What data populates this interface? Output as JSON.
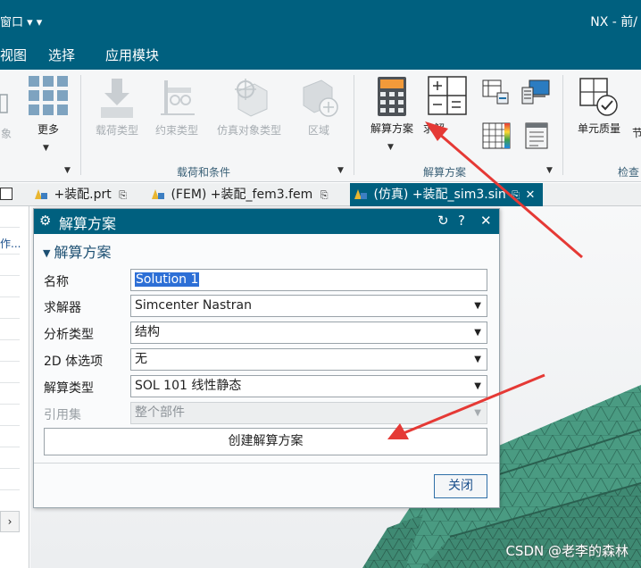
{
  "titlebar": {
    "left_text": "窗口 ▾  ▾",
    "right_text": "NX - 前/"
  },
  "menubar": {
    "items": [
      "视图",
      "选择",
      "应用模块"
    ]
  },
  "ribbon": {
    "buttons": {
      "more": "更多",
      "load_type": "载荷类型",
      "constraint_type": "约束类型",
      "sim_object_type": "仿真对象类型",
      "region": "区域",
      "solution": "解算方案",
      "solve": "求解",
      "element_quality": "单元质量",
      "partial_left": "象",
      "partial_right": "节"
    },
    "groups": {
      "loads_conditions": "载荷和条件",
      "solution": "解算方案",
      "check": "检查"
    }
  },
  "tabs": [
    {
      "label": "+装配.prt",
      "active": false
    },
    {
      "label": "(FEM) +装配_fem3.fem",
      "active": false
    },
    {
      "label": "(仿真) +装配_sim3.sin",
      "active": true
    }
  ],
  "left_panel": {
    "work_text": "作..."
  },
  "dialog": {
    "title": "解算方案",
    "section": "解算方案",
    "fields": {
      "name": {
        "label": "名称",
        "value": "Solution 1"
      },
      "solver": {
        "label": "求解器",
        "value": "Simcenter Nastran"
      },
      "analysis_type": {
        "label": "分析类型",
        "value": "结构"
      },
      "body_2d": {
        "label": "2D 体选项",
        "value": "无"
      },
      "solution_type": {
        "label": "解算类型",
        "value": "SOL 101 线性静态"
      },
      "reference_set": {
        "label": "引用集",
        "value": "整个部件"
      }
    },
    "create_button": "创建解算方案",
    "close_button": "关闭"
  },
  "watermark": "CSDN @老李的森林",
  "colors": {
    "brand": "#00607f",
    "mesh": "#4a9b82",
    "mesh_line": "#2f6f5c",
    "arrow": "#e53935",
    "selection": "#2d6fd6"
  }
}
